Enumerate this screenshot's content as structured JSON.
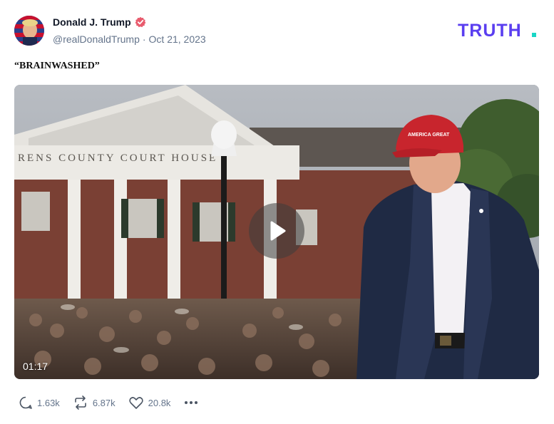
{
  "post": {
    "author": {
      "display_name": "Donald J. Trump",
      "handle": "@realDonaldTrump",
      "separator": "·",
      "date": "Oct 21, 2023",
      "verified_icon": "verified-badge-icon",
      "verified_color": "#e85b6d"
    },
    "brand": {
      "name": "TRUTH",
      "dot_color": "#19d6c6",
      "color": "#5a3ef0"
    },
    "text": "“BRAINWASHED”",
    "media": {
      "type": "video",
      "duration": "01:17",
      "scene_text": {
        "building_sign": "RENS COUNTY COURT HOUSE",
        "cap_text": "AMERICA GREAT"
      },
      "play_icon": "play-icon"
    },
    "actions": {
      "replies": {
        "icon": "reply-icon",
        "count": "1.63k"
      },
      "retruths": {
        "icon": "retruth-icon",
        "count": "6.87k"
      },
      "likes": {
        "icon": "heart-icon",
        "count": "20.8k"
      },
      "more_icon": "more-icon"
    }
  }
}
